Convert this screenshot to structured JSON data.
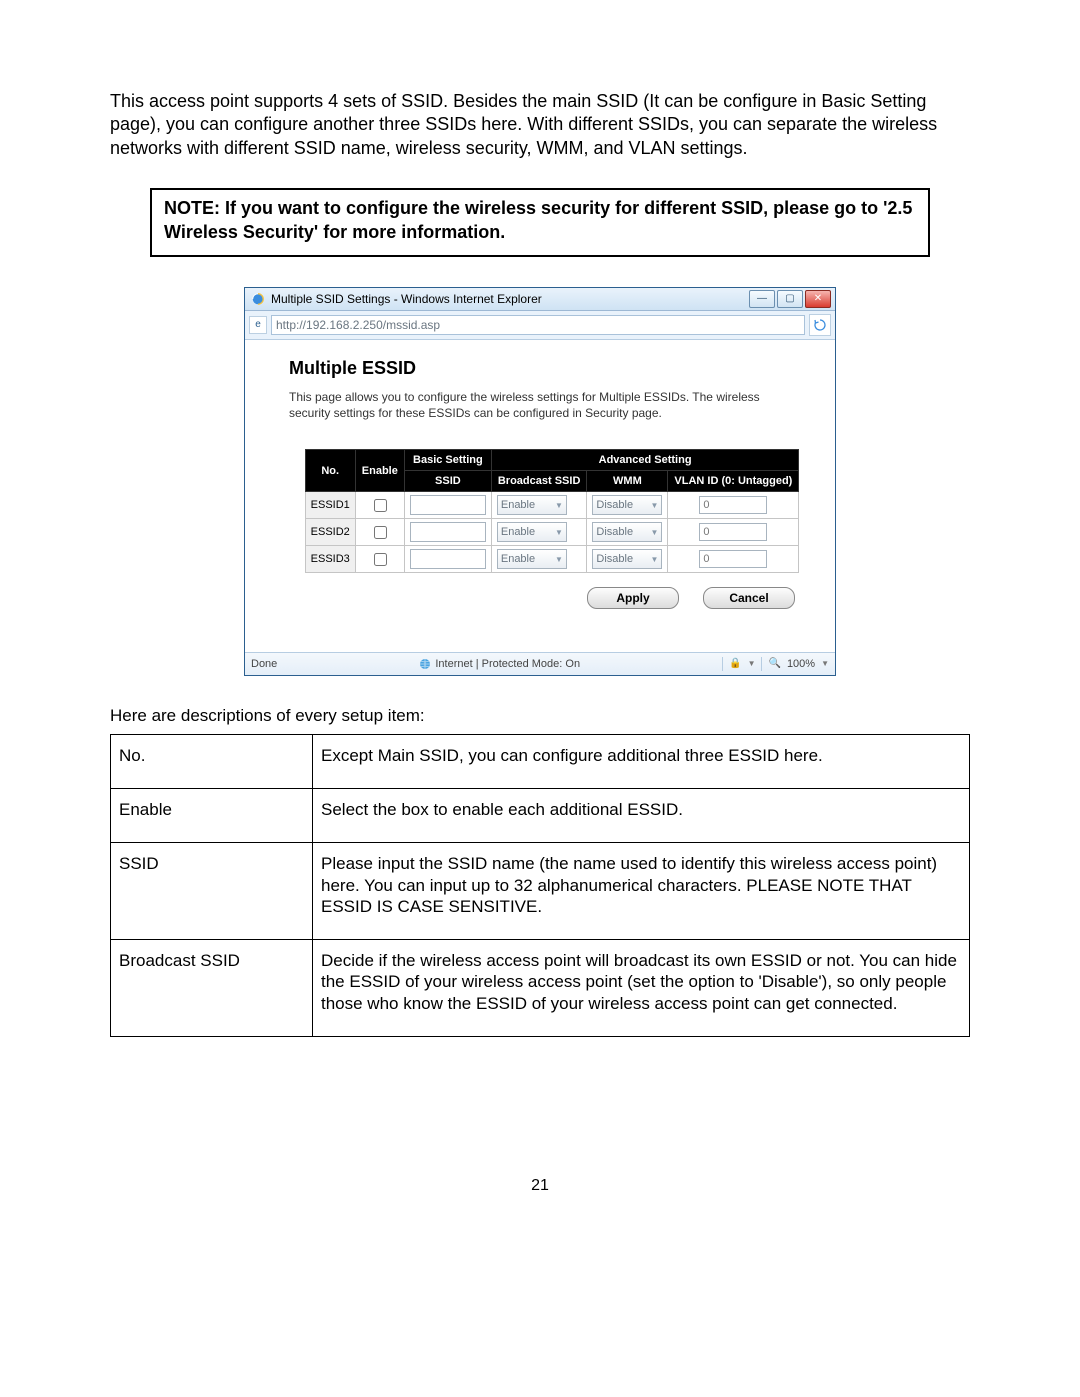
{
  "intro": "This access point supports 4 sets of SSID. Besides the main SSID (It can be configure in Basic Setting page), you can configure another three SSIDs here. With different SSIDs, you can separate the wireless networks with different SSID name, wireless security, WMM, and VLAN settings.",
  "note": "NOTE: If you want to configure the wireless security for different SSID, please go to '2.5 Wireless Security' for more information.",
  "browser": {
    "title": "Multiple SSID Settings - Windows Internet Explorer",
    "url": "http://192.168.2.250/mssid.asp",
    "status_left": "Done",
    "status_mid": "Internet | Protected Mode: On",
    "zoom": "100%"
  },
  "page": {
    "heading": "Multiple ESSID",
    "description": "This page allows you to configure the wireless settings for Multiple ESSIDs. The wireless security settings for these ESSIDs can be configured in Security page."
  },
  "headers": {
    "no": "No.",
    "enable": "Enable",
    "basic_setting": "Basic Setting",
    "advanced_setting": "Advanced Setting",
    "ssid": "SSID",
    "broadcast_ssid": "Broadcast SSID",
    "wmm": "WMM",
    "vlan": "VLAN ID (0: Untagged)"
  },
  "rows": [
    {
      "no": "ESSID1",
      "enable": false,
      "ssid": "",
      "broadcast": "Enable",
      "wmm": "Disable",
      "vlan": "0"
    },
    {
      "no": "ESSID2",
      "enable": false,
      "ssid": "",
      "broadcast": "Enable",
      "wmm": "Disable",
      "vlan": "0"
    },
    {
      "no": "ESSID3",
      "enable": false,
      "ssid": "",
      "broadcast": "Enable",
      "wmm": "Disable",
      "vlan": "0"
    }
  ],
  "buttons": {
    "apply": "Apply",
    "cancel": "Cancel"
  },
  "descriptions_intro": "Here are descriptions of every setup item:",
  "descriptions": [
    {
      "term": "No.",
      "desc": "Except Main SSID, you can configure additional three ESSID here."
    },
    {
      "term": "Enable",
      "desc": "Select the box to enable each additional ESSID."
    },
    {
      "term": "SSID",
      "desc": "Please input the SSID name (the name used to identify this wireless access point) here. You can input up to 32 alphanumerical characters. PLEASE NOTE THAT ESSID IS CASE SENSITIVE."
    },
    {
      "term": "Broadcast SSID",
      "desc": "Decide if the wireless access point will broadcast its own ESSID or not. You can hide the ESSID of your wireless access point (set the option to 'Disable'), so only people those who know the ESSID of your wireless access point can get connected."
    }
  ],
  "page_number": "21"
}
